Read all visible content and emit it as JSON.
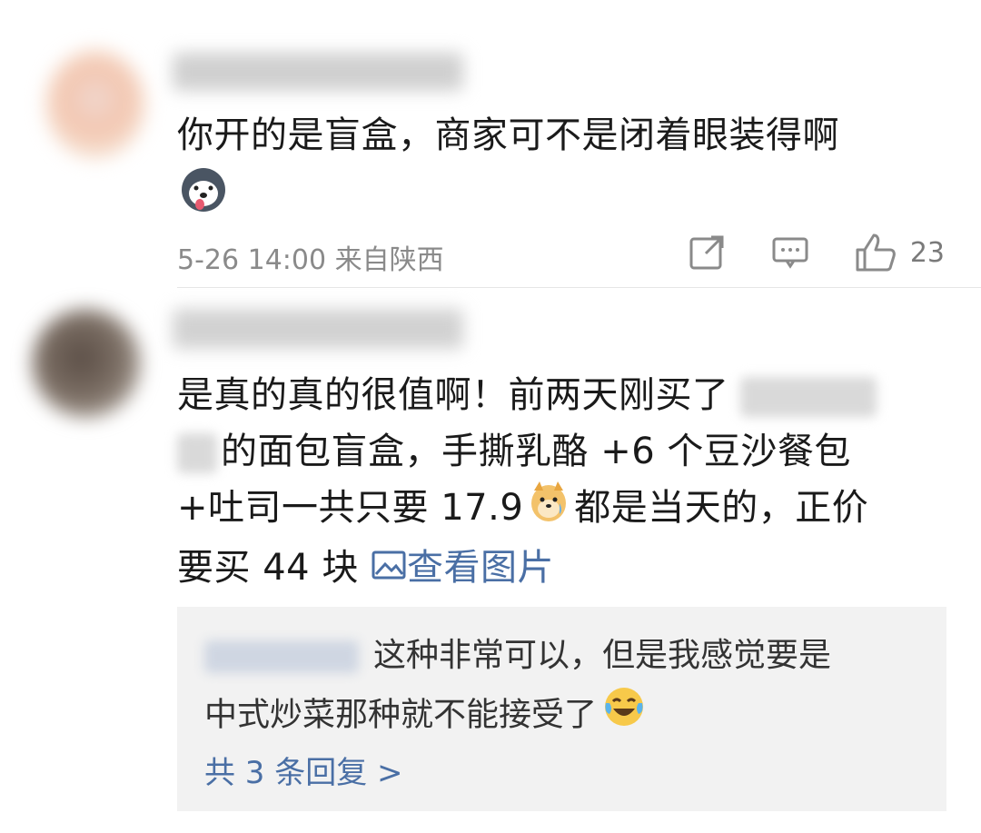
{
  "comments": [
    {
      "text": "你开的是盲盒，商家可不是闭着眼装得啊",
      "emoji": "husky-dog-emoji",
      "time": "5-26 14:00 来自陕西",
      "likes": "23"
    },
    {
      "text_line1": "是真的真的很值啊！前两天刚买了",
      "text_line2": "的面包盲盒，手撕乳酪 +6 个豆沙餐包",
      "text_line3a": "+吐司一共只要 17.9",
      "text_line3b": "都是当天的，正价",
      "text_line4": "要买 44 块",
      "view_image": "查看图片",
      "emoji": "doge-emoji",
      "reply": {
        "text_line1": "这种非常可以，但是我感觉要是",
        "text_line2": "中式炒菜那种就不能接受了",
        "emoji": "laugh-cry-emoji",
        "more": "共 3 条回复 >"
      }
    }
  ],
  "colors": {
    "link": "#4a6fa5",
    "meta": "#8a8a8a",
    "reply_bg": "#f2f2f2"
  }
}
